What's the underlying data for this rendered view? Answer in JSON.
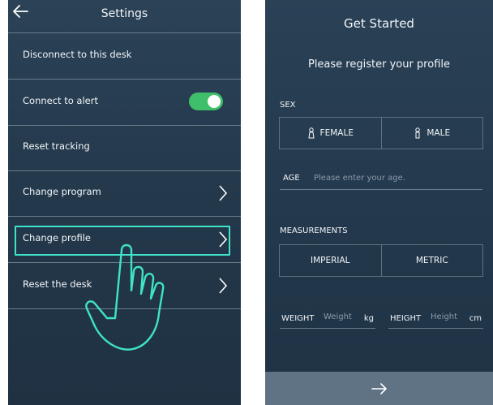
{
  "settings": {
    "title": "Settings",
    "items": [
      {
        "label": "Disconnect to this desk"
      },
      {
        "label": "Connect to alert"
      },
      {
        "label": "Reset tracking"
      },
      {
        "label": "Change program"
      },
      {
        "label": "Change profile"
      },
      {
        "label": "Reset the desk"
      }
    ],
    "alert_toggle_on": true,
    "toggle_color": "#3fbf6a",
    "highlight_color": "#3fe3c6"
  },
  "register": {
    "title": "Get Started",
    "subtitle": "Please register your profile",
    "sex_label": "SEX",
    "female_label": "FEMALE",
    "male_label": "MALE",
    "age_label": "AGE",
    "age_placeholder": "Please enter your age.",
    "measurements_label": "MEASUREMENTS",
    "imperial_label": "IMPERIAL",
    "metric_label": "METRIC",
    "weight_label": "WEIGHT",
    "weight_placeholder": "Weight",
    "weight_unit": "kg",
    "height_label": "HEIGHT",
    "height_placeholder": "Height",
    "height_unit": "cm",
    "next_icon": "arrow-right-icon"
  }
}
